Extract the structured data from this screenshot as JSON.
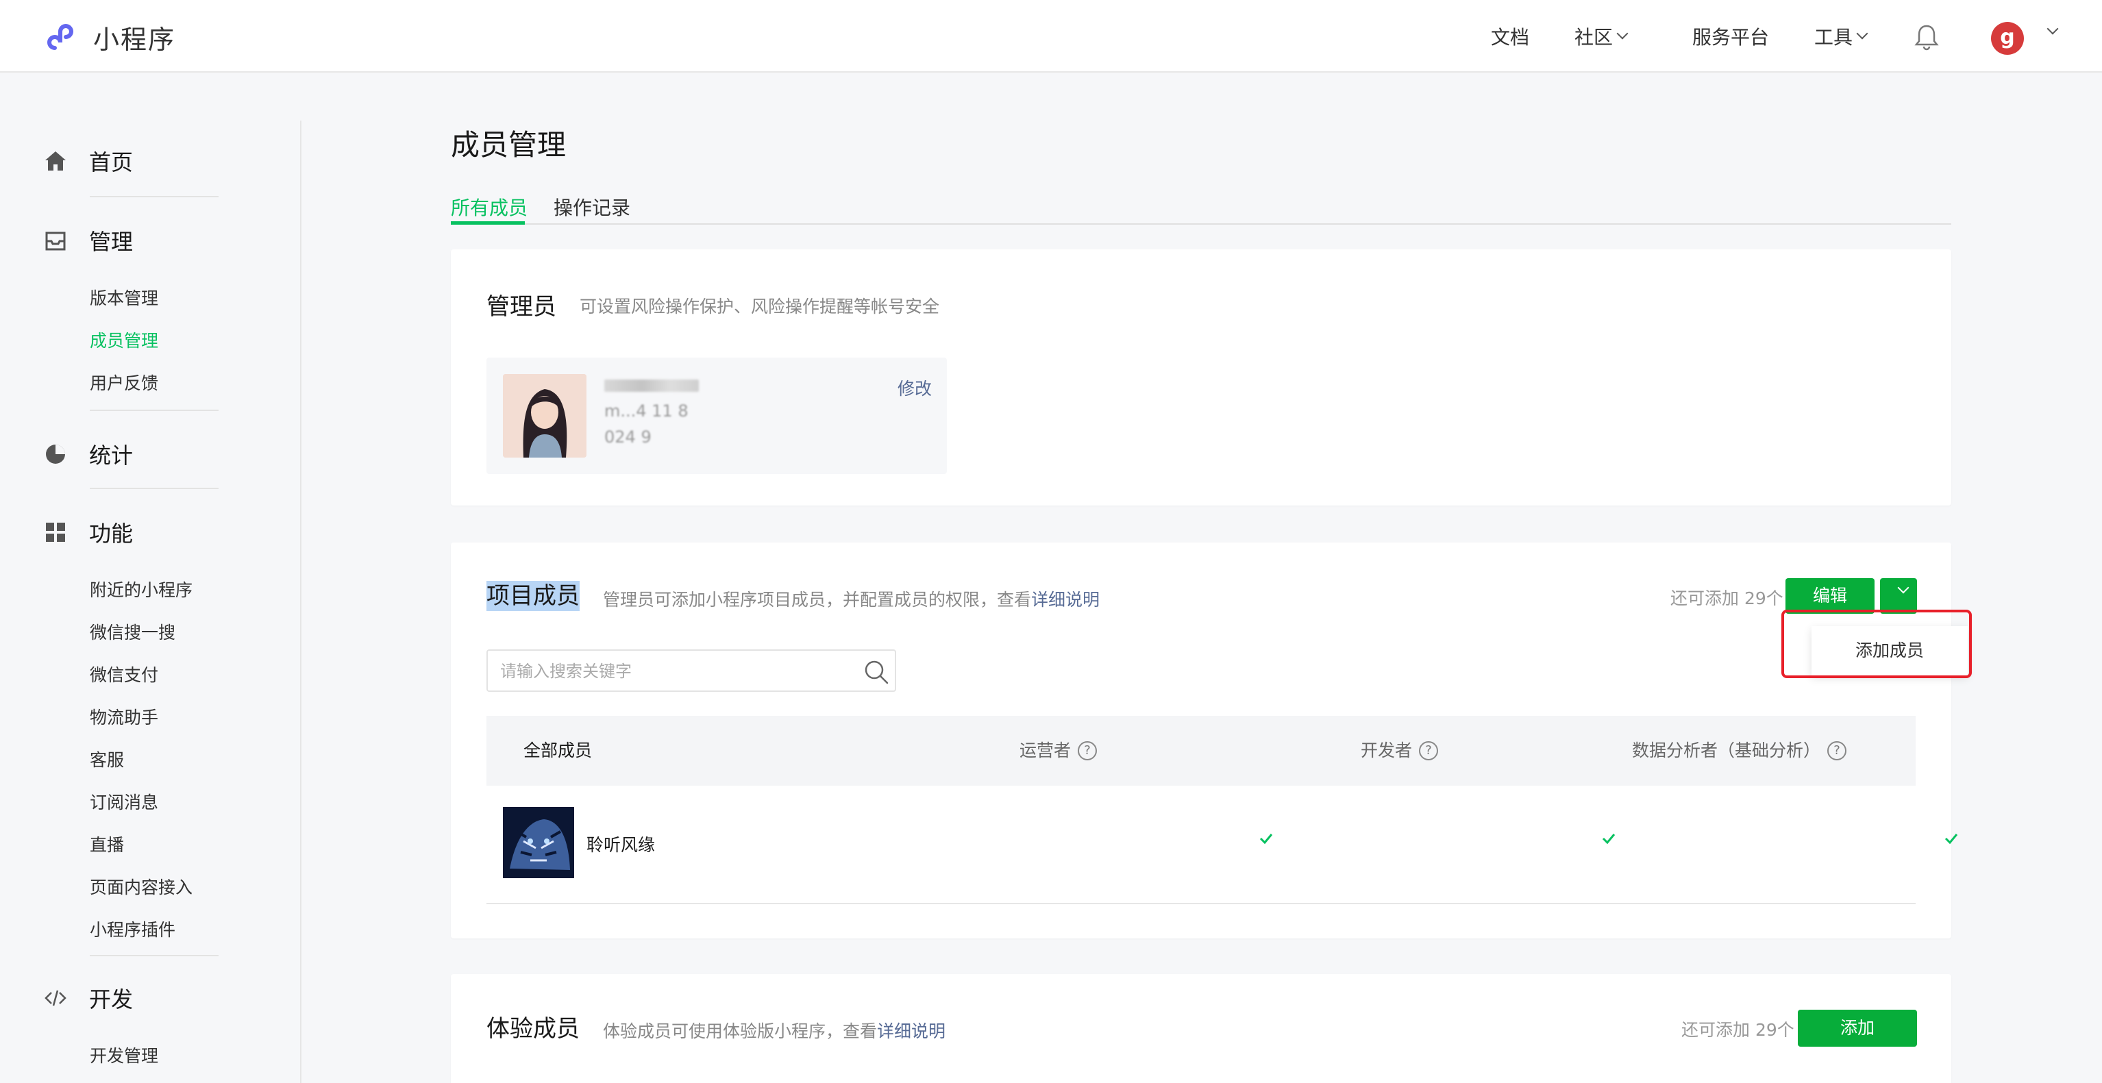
{
  "topbar": {
    "app_name": "小程序",
    "nav": {
      "docs": "文档",
      "community": "社区",
      "service_platform": "服务平台",
      "tools": "工具"
    },
    "avatar_letter": "g"
  },
  "sidebar": {
    "home": "首页",
    "manage": "管理",
    "manage_items": [
      "版本管理",
      "成员管理",
      "用户反馈"
    ],
    "stats": "统计",
    "features": "功能",
    "feature_items": [
      "附近的小程序",
      "微信搜一搜",
      "微信支付",
      "物流助手",
      "客服",
      "订阅消息",
      "直播",
      "页面内容接入",
      "小程序插件"
    ],
    "dev": "开发",
    "dev_items": [
      "开发管理"
    ]
  },
  "main": {
    "title": "成员管理",
    "tabs": [
      "所有成员",
      "操作记录"
    ],
    "admin": {
      "title": "管理员",
      "desc": "可设置风险操作保护、风险操作提醒等帐号安全",
      "modify": "修改",
      "blur_line2": "m...4 11 8",
      "blur_line3": "024 9"
    },
    "project": {
      "title": "项目成员",
      "desc": "管理员可添加小程序项目成员，并配置成员的权限，查看",
      "desc_link": "详细说明",
      "can_add": "还可添加 29个",
      "edit_button": "编辑",
      "dropdown_item": "添加成员",
      "search_placeholder": "请输入搜索关键字",
      "columns": [
        "全部成员",
        "运营者",
        "开发者",
        "数据分析者（基础分析）"
      ],
      "help_glyph": "?",
      "rows": [
        {
          "name": "聆听风缘",
          "operator": true,
          "developer": true,
          "analyst": true
        }
      ]
    },
    "experience": {
      "title": "体验成员",
      "desc": "体验成员可使用体验版小程序，查看",
      "desc_link": "详细说明",
      "can_add": "还可添加 29个",
      "add_button": "添加"
    }
  },
  "colors": {
    "accent_green": "#07c160",
    "button_green": "#07ad3a",
    "link": "#576b95",
    "alert_red": "#e8202a"
  }
}
